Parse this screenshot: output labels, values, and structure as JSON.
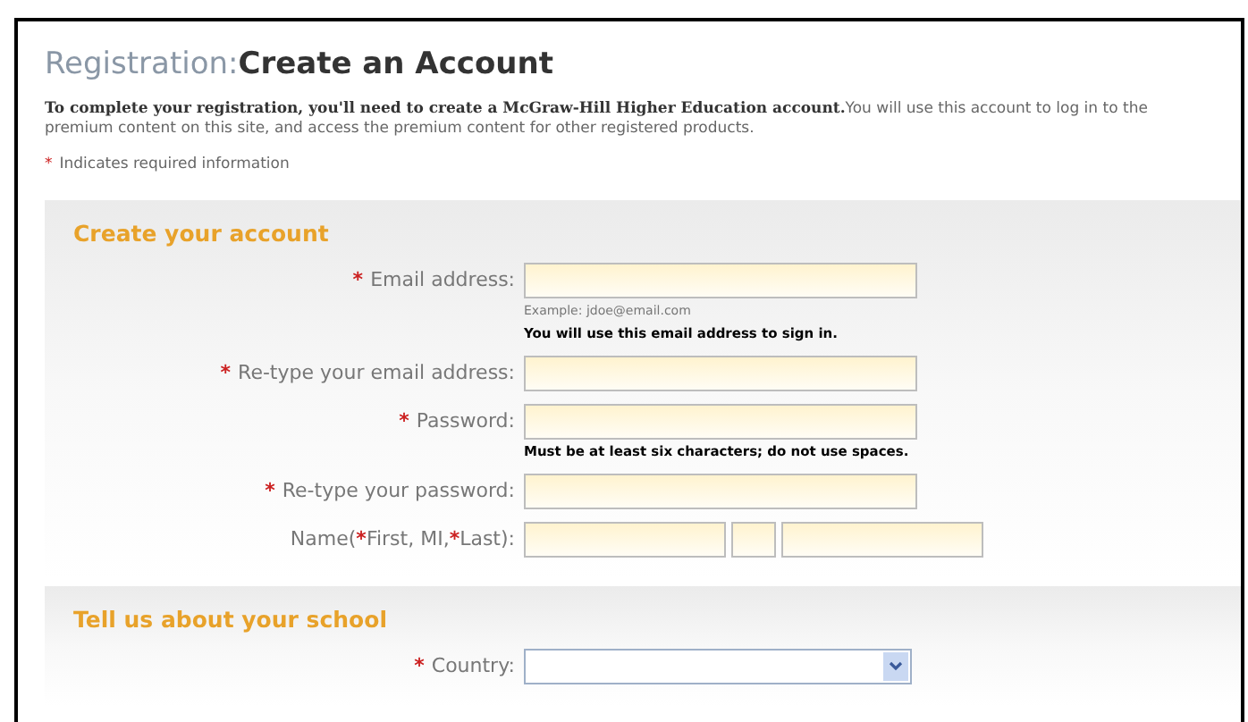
{
  "heading": {
    "prefix": "Registration:",
    "title": "Create an Account"
  },
  "intro": {
    "bold": "To complete your registration, you'll need to create a McGraw-Hill Higher Education account.",
    "rest": "You will use this account to log in to the premium content on this site, and access the premium content for other registered products."
  },
  "required_note": {
    "mark": "*",
    "text": "Indicates required information"
  },
  "sections": [
    {
      "title": "Create your account",
      "fields": [
        {
          "kind": "text",
          "required": true,
          "label": "Email address:",
          "example": "Example: jdoe@email.com",
          "hint": "You will use this email address to sign in."
        },
        {
          "kind": "text",
          "required": true,
          "label": "Re-type your email address:"
        },
        {
          "kind": "text",
          "required": true,
          "label": "Password:",
          "hint": "Must be at least six characters; do not use spaces."
        },
        {
          "kind": "text",
          "required": true,
          "label": "Re-type your password:"
        },
        {
          "kind": "name",
          "label_parts": [
            {
              "text": "Name(",
              "required": false
            },
            {
              "text": "*",
              "required": true
            },
            {
              "text": "First, MI,",
              "required": false
            },
            {
              "text": "*",
              "required": true
            },
            {
              "text": "Last):",
              "required": false
            }
          ]
        }
      ]
    },
    {
      "title": "Tell us about your school",
      "fields": [
        {
          "kind": "select",
          "required": true,
          "label": "Country:"
        }
      ]
    }
  ]
}
